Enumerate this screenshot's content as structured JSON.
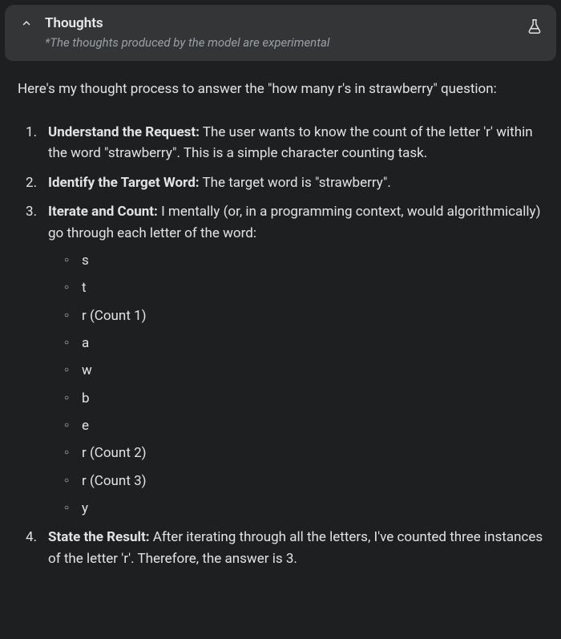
{
  "header": {
    "title": "Thoughts",
    "subtitle": "*The thoughts produced by the model are experimental"
  },
  "intro": "Here's my thought process to answer the \"how many r's in strawberry\" question:",
  "steps": [
    {
      "title": "Understand the Request:",
      "body": " The user wants to know the count of the letter 'r' within the word \"strawberry\". This is a simple character counting task."
    },
    {
      "title": "Identify the Target Word:",
      "body": " The target word is \"strawberry\"."
    },
    {
      "title": "Iterate and Count:",
      "body": " I mentally (or, in a programming context, would algorithmically) go through each letter of the word:",
      "sublist": [
        "s",
        "t",
        "r (Count 1)",
        "a",
        "w",
        "b",
        "e",
        "r (Count 2)",
        "r (Count 3)",
        "y"
      ]
    },
    {
      "title": "State the Result:",
      "body": " After iterating through all the letters, I've counted three instances of the letter 'r'. Therefore, the answer is 3."
    }
  ]
}
